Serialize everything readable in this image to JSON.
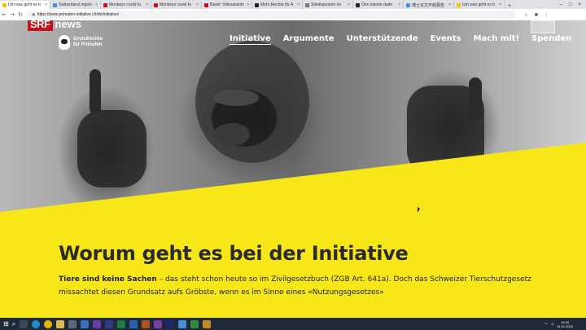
{
  "browser": {
    "tabs": [
      {
        "label": "Um was geht es b",
        "color": "#f4c400",
        "active": true
      },
      {
        "label": "Switzerland region",
        "color": "#4a8bd6"
      },
      {
        "label": "Monkeys could fu",
        "color": "#c4121a"
      },
      {
        "label": "Monkeys could fu",
        "color": "#c4121a"
      },
      {
        "label": "Basel: Volksabstim",
        "color": "#c4121a"
      },
      {
        "label": "Mehr Rechte für A",
        "color": "#222222"
      },
      {
        "label": "Sitedlupzoom on",
        "color": "#777777"
      },
      {
        "label": "Ove tokone dude",
        "color": "#222222"
      },
      {
        "label": "博士论文开题报告",
        "color": "#4a8bd6"
      },
      {
        "label": "Um was geht es b",
        "color": "#f4c400"
      }
    ],
    "new_tab": "+",
    "url": "https://www.primaten-initiative.ch/de/initiative/"
  },
  "overlay": {
    "srf": "SRF",
    "news": "news"
  },
  "site": {
    "logo_line1": "Grundrechte",
    "logo_line2": "für Primaten",
    "nav": [
      "Initiative",
      "Argumente",
      "Unterstützende",
      "Events",
      "Mach mit!",
      "Spenden"
    ],
    "headline": "Worum geht es bei der Initiative",
    "body_bold": "Tiere sind keine Sachen",
    "body_rest": " – das steht schon heute so im Zivilgesetzbuch (ZGB Art. 641a). Doch das Schweizer Tierschutzgesetz missachtet diesen Grundsatz aufs Gröbste, wenn es im Sinne eines «Nutzungsgesetzes»"
  },
  "taskbar": {
    "time": "10:40",
    "date": "14.01.2022"
  },
  "colors": {
    "yellow": "#f7e719",
    "srf_red": "#c4121a",
    "taskbar": "#1f2a36"
  }
}
